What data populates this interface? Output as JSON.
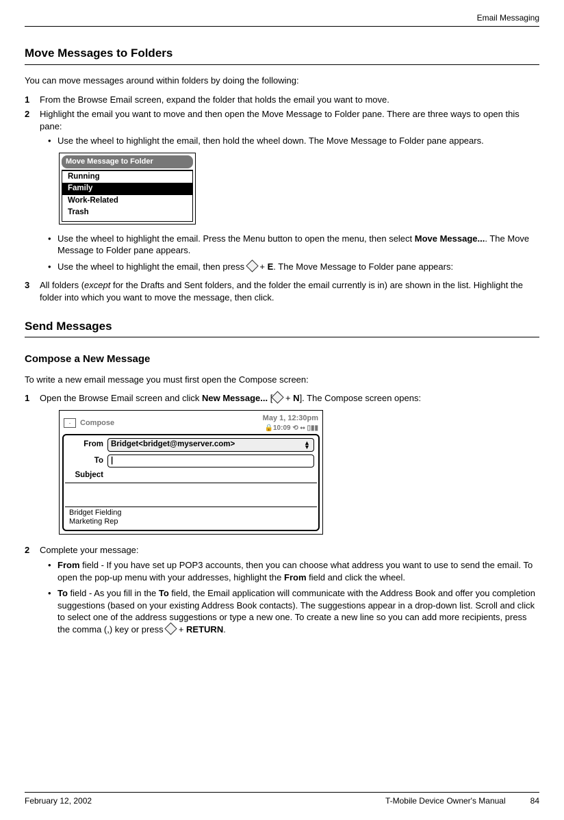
{
  "header": {
    "running": "Email Messaging"
  },
  "sect1": {
    "title": "Move Messages to Folders",
    "intro": "You can move messages around within folders by doing the following:",
    "step1": {
      "num": "1",
      "text": "From the Browse Email screen, expand the folder that holds the email you want to move."
    },
    "step2": {
      "num": "2",
      "text": "Highlight the email you want to move and then open the Move Message to Folder pane. There are three ways to open this pane:",
      "b1": "Use the wheel to highlight the email, then hold the wheel down. The Move Message to Folder pane appears.",
      "b2a": "Use the wheel to highlight the email. Press the Menu button to open the menu, then select ",
      "b2b": "Move Message...",
      "b2c": ". The Move Message to Folder pane appears.",
      "b3a": "Use the wheel to highlight the email, then press ",
      "b3b": " + ",
      "b3c": "E",
      "b3d": ". The Move Message to Folder pane appears:"
    },
    "step3": {
      "num": "3",
      "a": "All folders (",
      "b": "except",
      "c": " for the Drafts and Sent folders, and the folder the email currently is in) are shown in the list. Highlight the folder into which you want to move the message, then click."
    },
    "figMove": {
      "title": "Move Message to Folder",
      "items": [
        "Running",
        "Family",
        "Work-Related",
        "Trash"
      ],
      "selectedIndex": 1
    }
  },
  "sect2": {
    "title": "Send Messages",
    "sub1": {
      "title": "Compose a New Message",
      "intro": "To write a new email message you must first open the Compose screen:",
      "step1": {
        "num": "1",
        "a": "Open the Browse Email screen and click ",
        "b": "New Message...",
        "c": " [",
        "d": " + ",
        "e": "N",
        "f": "]. The Compose screen opens:"
      },
      "figCompose": {
        "datetime": "May 1, 12:30pm",
        "clock": "10:09",
        "label": "Compose",
        "fromLabel": "From",
        "fromValue": "Bridget<bridget@myserver.com>",
        "toLabel": "To",
        "toValue": "|",
        "subjectLabel": "Subject",
        "sig1": "Bridget Fielding",
        "sig2": "Marketing Rep"
      },
      "step2": {
        "num": "2",
        "text": "Complete your message:",
        "b1a": "From",
        "b1b": " field - If you have set up POP3 accounts, then you can choose what address you want to use to send the email. To open the pop-up menu with your addresses, highlight the ",
        "b1c": "From",
        "b1d": " field and click the wheel.",
        "b2a": "To",
        "b2b": " field - As you fill in the ",
        "b2c": "To",
        "b2d": " field, the Email application will communicate with the Address Book and offer you completion suggestions (based on your existing Address Book contacts). The suggestions appear in a drop-down list. Scroll and click to select one of the address suggestions or type a new one. To create a new line so you can add more recipients, press the comma (,) key or press ",
        "b2e": " + ",
        "b2f": "RETURN",
        "b2g": "."
      }
    }
  },
  "footer": {
    "date": "February 12, 2002",
    "manual": "T-Mobile Device Owner's Manual",
    "page": "84"
  }
}
